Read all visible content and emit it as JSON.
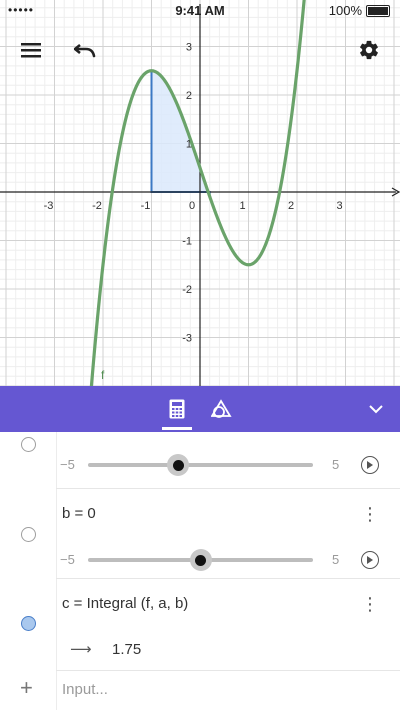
{
  "status_bar": {
    "signal": "••••• ",
    "time": "9:41 AM",
    "battery": "100%"
  },
  "graph": {
    "function_label": "f",
    "x_ticks": [
      "-3",
      "-2",
      "-1",
      "0",
      "1",
      "2",
      "3"
    ],
    "y_ticks": [
      "3",
      "2",
      "1",
      "-1",
      "-2",
      "-3"
    ],
    "curve_color": "#6aa36a",
    "fill_color": "#dbe9fb",
    "fill_edge_color": "#3b79c4"
  },
  "toolbar": {
    "color": "#6557d2",
    "tabs": [
      {
        "name": "calculator-icon"
      },
      {
        "name": "shapes-icon"
      }
    ]
  },
  "algebra": {
    "row_a": {
      "slider_min": "−5",
      "slider_max": "5",
      "value": 0.4
    },
    "row_b": {
      "expression": "b = 0",
      "slider_min": "−5",
      "slider_max": "5",
      "value": 0.5
    },
    "row_c": {
      "expression": "c = Integral (f, a, b)",
      "result": "1.75",
      "arrow": "⟶"
    },
    "input_placeholder": "Input...",
    "add_symbol": "+"
  }
}
